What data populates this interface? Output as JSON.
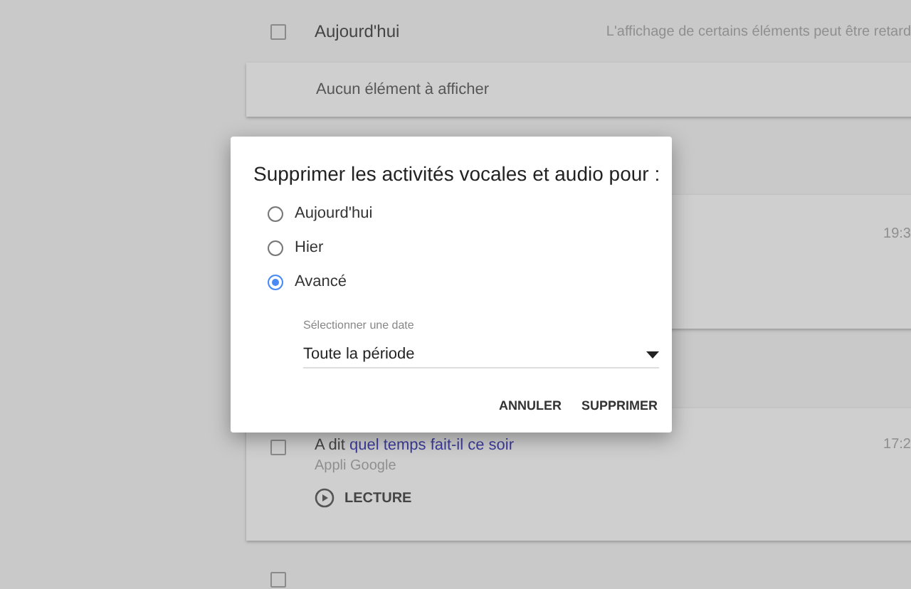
{
  "background": {
    "day_header": {
      "label": "Aujourd'hui",
      "checked": false,
      "note": "L'affichage de certains éléments peut être retard"
    },
    "empty_card": {
      "text": "Aucun élément à afficher"
    },
    "hidden_card": {
      "time": "19:3"
    },
    "activity": {
      "checked": false,
      "prefix": "A dit",
      "query": "quel temps fait-il ce soir",
      "source": "Appli Google",
      "play_label": "LECTURE",
      "time": "17:2"
    },
    "next_day": {
      "checked": false
    }
  },
  "dialog": {
    "title": "Supprimer les activités vocales et audio pour :",
    "options": [
      {
        "label": "Aujourd'hui",
        "selected": false
      },
      {
        "label": "Hier",
        "selected": false
      },
      {
        "label": "Avancé",
        "selected": true
      }
    ],
    "date_select": {
      "label": "Sélectionner une date",
      "value": "Toute la période"
    },
    "buttons": [
      "ANNULER",
      "SUPPRIMER"
    ]
  }
}
